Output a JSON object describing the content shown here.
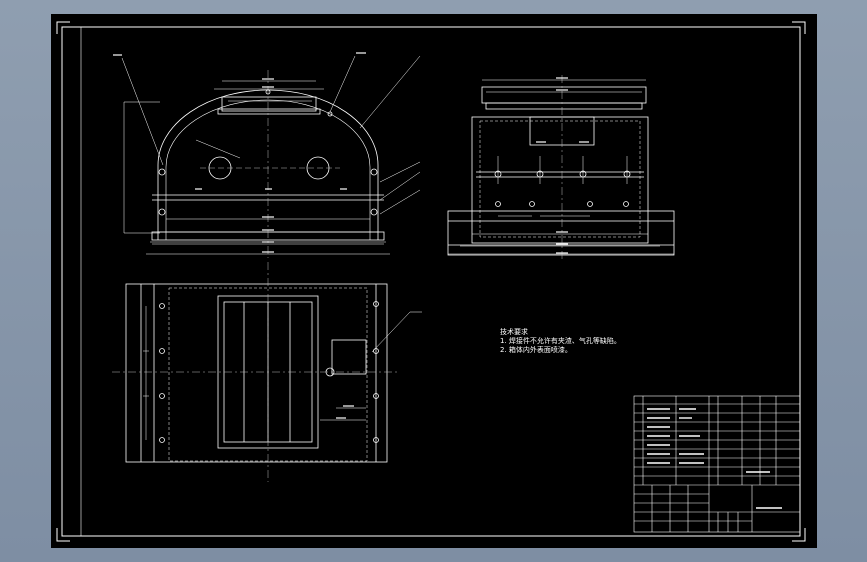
{
  "drawing": {
    "tech_requirements_title": "技术要求",
    "tech_requirements": [
      "1. 焊接件不允许有夹渣、气孔等缺陷。",
      "2. 箱体内外表面喷漆。"
    ],
    "colors": {
      "background": "#8f9eb0",
      "sheet": "#000000",
      "line": "#ffffff",
      "center_line": "#bbbbbb"
    }
  }
}
